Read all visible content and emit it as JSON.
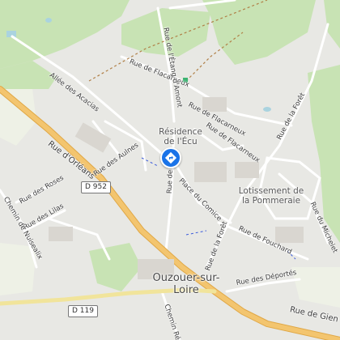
{
  "map": {
    "roads": {
      "allee_acacias": "Allée des Acacias",
      "rue_flacarneux_1": "Rue de Flacarneux",
      "rue_flacarneux_2": "Rue de Flacarneux",
      "rue_flacarneux_3": "Rue de Flacarneux",
      "rue_etang": "Rue de l'Étang d'Amont",
      "rue_foret_1": "Rue de la Forêt",
      "rue_foret_2": "Rue de la Forêt",
      "rue_orleans": "Rue d'Orléans",
      "rue_aulnes": "Rue des Aulnes",
      "rue_roses": "Rue des Roses",
      "rue_lilas": "Rue des Lilas",
      "chemin_nuisealix": "Chemin de Nuisealix",
      "rue_ecu": "Rue de l'Écu",
      "place_comice": "Place du Comice",
      "rue_fouchard": "Rue de Fouchard",
      "rue_micheiet": "Rue du Micheiet",
      "rue_deportes": "Rue des Déportés",
      "chemin_remy": "Chemin Rémy",
      "rue_gien": "Rue de Gien"
    },
    "shields": {
      "d952": "D 952",
      "d119": "D 119"
    },
    "places": {
      "residence": "Résidence de l'Écu",
      "lotissement": "Lotissement de la Pommeraie",
      "town": "Ouzouer-sur-Loire"
    },
    "poi_icon": "directions-marker-icon",
    "colors": {
      "forest": "#c8e3b4",
      "road": "#ffffff",
      "main_road": "#f3c56f",
      "poi": "#1a73e8"
    }
  }
}
